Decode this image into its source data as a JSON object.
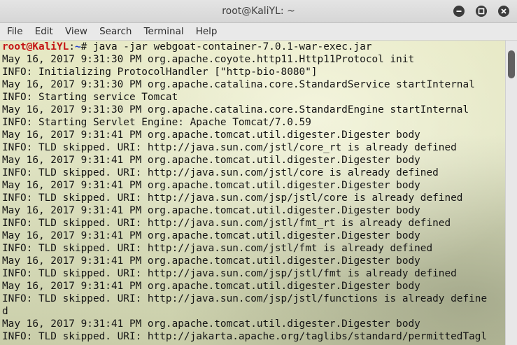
{
  "window": {
    "title": "root@KaliYL: ~",
    "buttons": [
      "minimize",
      "maximize",
      "close"
    ]
  },
  "menu": {
    "items": [
      "File",
      "Edit",
      "View",
      "Search",
      "Terminal",
      "Help"
    ]
  },
  "terminal": {
    "prompt": {
      "user_host": "root@KaliYL",
      "separator": ":",
      "path": "~",
      "symbol": "# ",
      "command": "java -jar webgoat-container-7.0.1-war-exec.jar"
    },
    "output": [
      "May 16, 2017 9:31:30 PM org.apache.coyote.http11.Http11Protocol init",
      "INFO: Initializing ProtocolHandler [\"http-bio-8080\"]",
      "May 16, 2017 9:31:30 PM org.apache.catalina.core.StandardService startInternal",
      "INFO: Starting service Tomcat",
      "May 16, 2017 9:31:30 PM org.apache.catalina.core.StandardEngine startInternal",
      "INFO: Starting Servlet Engine: Apache Tomcat/7.0.59",
      "May 16, 2017 9:31:41 PM org.apache.tomcat.util.digester.Digester body",
      "INFO: TLD skipped. URI: http://java.sun.com/jstl/core_rt is already defined",
      "May 16, 2017 9:31:41 PM org.apache.tomcat.util.digester.Digester body",
      "INFO: TLD skipped. URI: http://java.sun.com/jstl/core is already defined",
      "May 16, 2017 9:31:41 PM org.apache.tomcat.util.digester.Digester body",
      "INFO: TLD skipped. URI: http://java.sun.com/jsp/jstl/core is already defined",
      "May 16, 2017 9:31:41 PM org.apache.tomcat.util.digester.Digester body",
      "INFO: TLD skipped. URI: http://java.sun.com/jstl/fmt_rt is already defined",
      "May 16, 2017 9:31:41 PM org.apache.tomcat.util.digester.Digester body",
      "INFO: TLD skipped. URI: http://java.sun.com/jstl/fmt is already defined",
      "May 16, 2017 9:31:41 PM org.apache.tomcat.util.digester.Digester body",
      "INFO: TLD skipped. URI: http://java.sun.com/jsp/jstl/fmt is already defined",
      "May 16, 2017 9:31:41 PM org.apache.tomcat.util.digester.Digester body",
      "INFO: TLD skipped. URI: http://java.sun.com/jsp/jstl/functions is already define",
      "d",
      "May 16, 2017 9:31:41 PM org.apache.tomcat.util.digester.Digester body",
      "INFO: TLD skipped. URI: http://jakarta.apache.org/taglibs/standard/permittedTagl"
    ]
  }
}
